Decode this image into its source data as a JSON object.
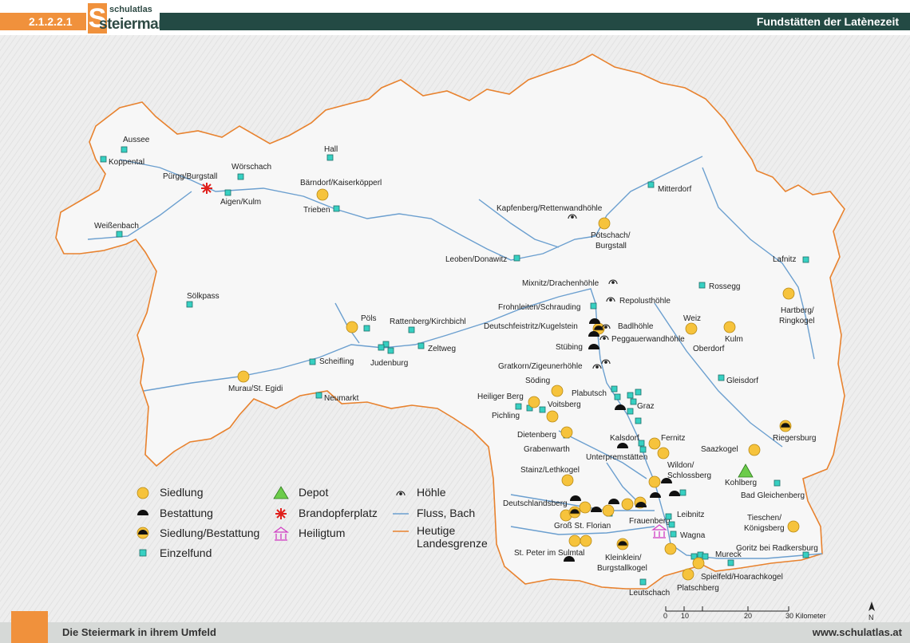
{
  "header": {
    "code": "2.1.2.2.1",
    "logo_top": "schulatlas",
    "logo_bottom": "steiermark",
    "logo_letter": "S",
    "title": "Fundstätten der Latènezeit"
  },
  "footer": {
    "left": "Die Steiermark in ihrem Umfeld",
    "right": "www.schulatlas.at"
  },
  "colors": {
    "accent": "#f0913c",
    "header_bar": "#234a44",
    "river": "#6b9fcf",
    "border": "#e8822e",
    "settlement": "#f6c33c",
    "single_find": "#37d0c2",
    "burial": "#111111",
    "depot": "#6ccc4a",
    "fire_altar": "#e0201c",
    "sanctuary": "#d13fc4",
    "footer_bg": "#d6d9d7"
  },
  "legend": {
    "siedlung": "Siedlung",
    "bestattung": "Bestattung",
    "siedlung_bestattung": "Siedlung/Bestattung",
    "einzelfund": "Einzelfund",
    "depot": "Depot",
    "brandopferplatz": "Brandopferplatz",
    "heiligtum": "Heiligtum",
    "hoehle": "Höhle",
    "fluss": "Fluss, Bach",
    "grenze_1": "Heutige",
    "grenze_2": "Landesgrenze"
  },
  "scale": {
    "labels": [
      "0",
      "10",
      "20",
      "30 Kilometer"
    ]
  },
  "north": "N",
  "places": [
    "Aussee",
    "Koppental",
    "Pürgg/Burgstall",
    "Wörschach",
    "Hall",
    "Aigen/Kulm",
    "Bärndorf/Kaiserköpperl",
    "Trieben",
    "Weißenbach",
    "Mitterdorf",
    "Kapfenberg/Rettenwandhöhle",
    "Pötschach/",
    "Burgstall",
    "Leoben/Donawitz",
    "Lafnitz",
    "Mixnitz/Drachenhöhle",
    "Rossegg",
    "Frohnleiten/Schrauding",
    "Repolusthöhle",
    "Hartberg/",
    "Ringkogel",
    "Sölkpass",
    "Pöls",
    "Rattenberg/Kirchbichl",
    "Deutschfeistritz/Kugelstein",
    "Badlhöhle",
    "Peggauerwandhöhle",
    "Weiz",
    "Kulm",
    "Oberdorf",
    "Stübing",
    "Zeltweg",
    "Scheifling",
    "Judenburg",
    "Gratkorn/Zigeunerhöhle",
    "Gleisdorf",
    "Söding",
    "Murau/St. Egidi",
    "Neumarkt",
    "Heiliger Berg",
    "Plabutsch",
    "Graz",
    "Pichling",
    "Voitsberg",
    "Riegersburg",
    "Dietenberg",
    "Kalsdorf",
    "Fernitz",
    "Grabenwarth",
    "Unterpremstätten",
    "Saazkogel",
    "Wildon/",
    "Schlossberg",
    "Stainz/Lethkogel",
    "Kohlberg",
    "Bad Gleichenberg",
    "Deutschlandsberg",
    "Leibnitz",
    "Groß St. Florian",
    "Frauenberg",
    "Wagna",
    "Tieschen/",
    "Königsberg",
    "St. Peter im Sulmtal",
    "Kleinklein/",
    "Burgstallkogel",
    "Mureck",
    "Goritz bei Radkersburg",
    "Spielfeld/Hoarachkogel",
    "Platschberg",
    "Leutschach"
  ]
}
